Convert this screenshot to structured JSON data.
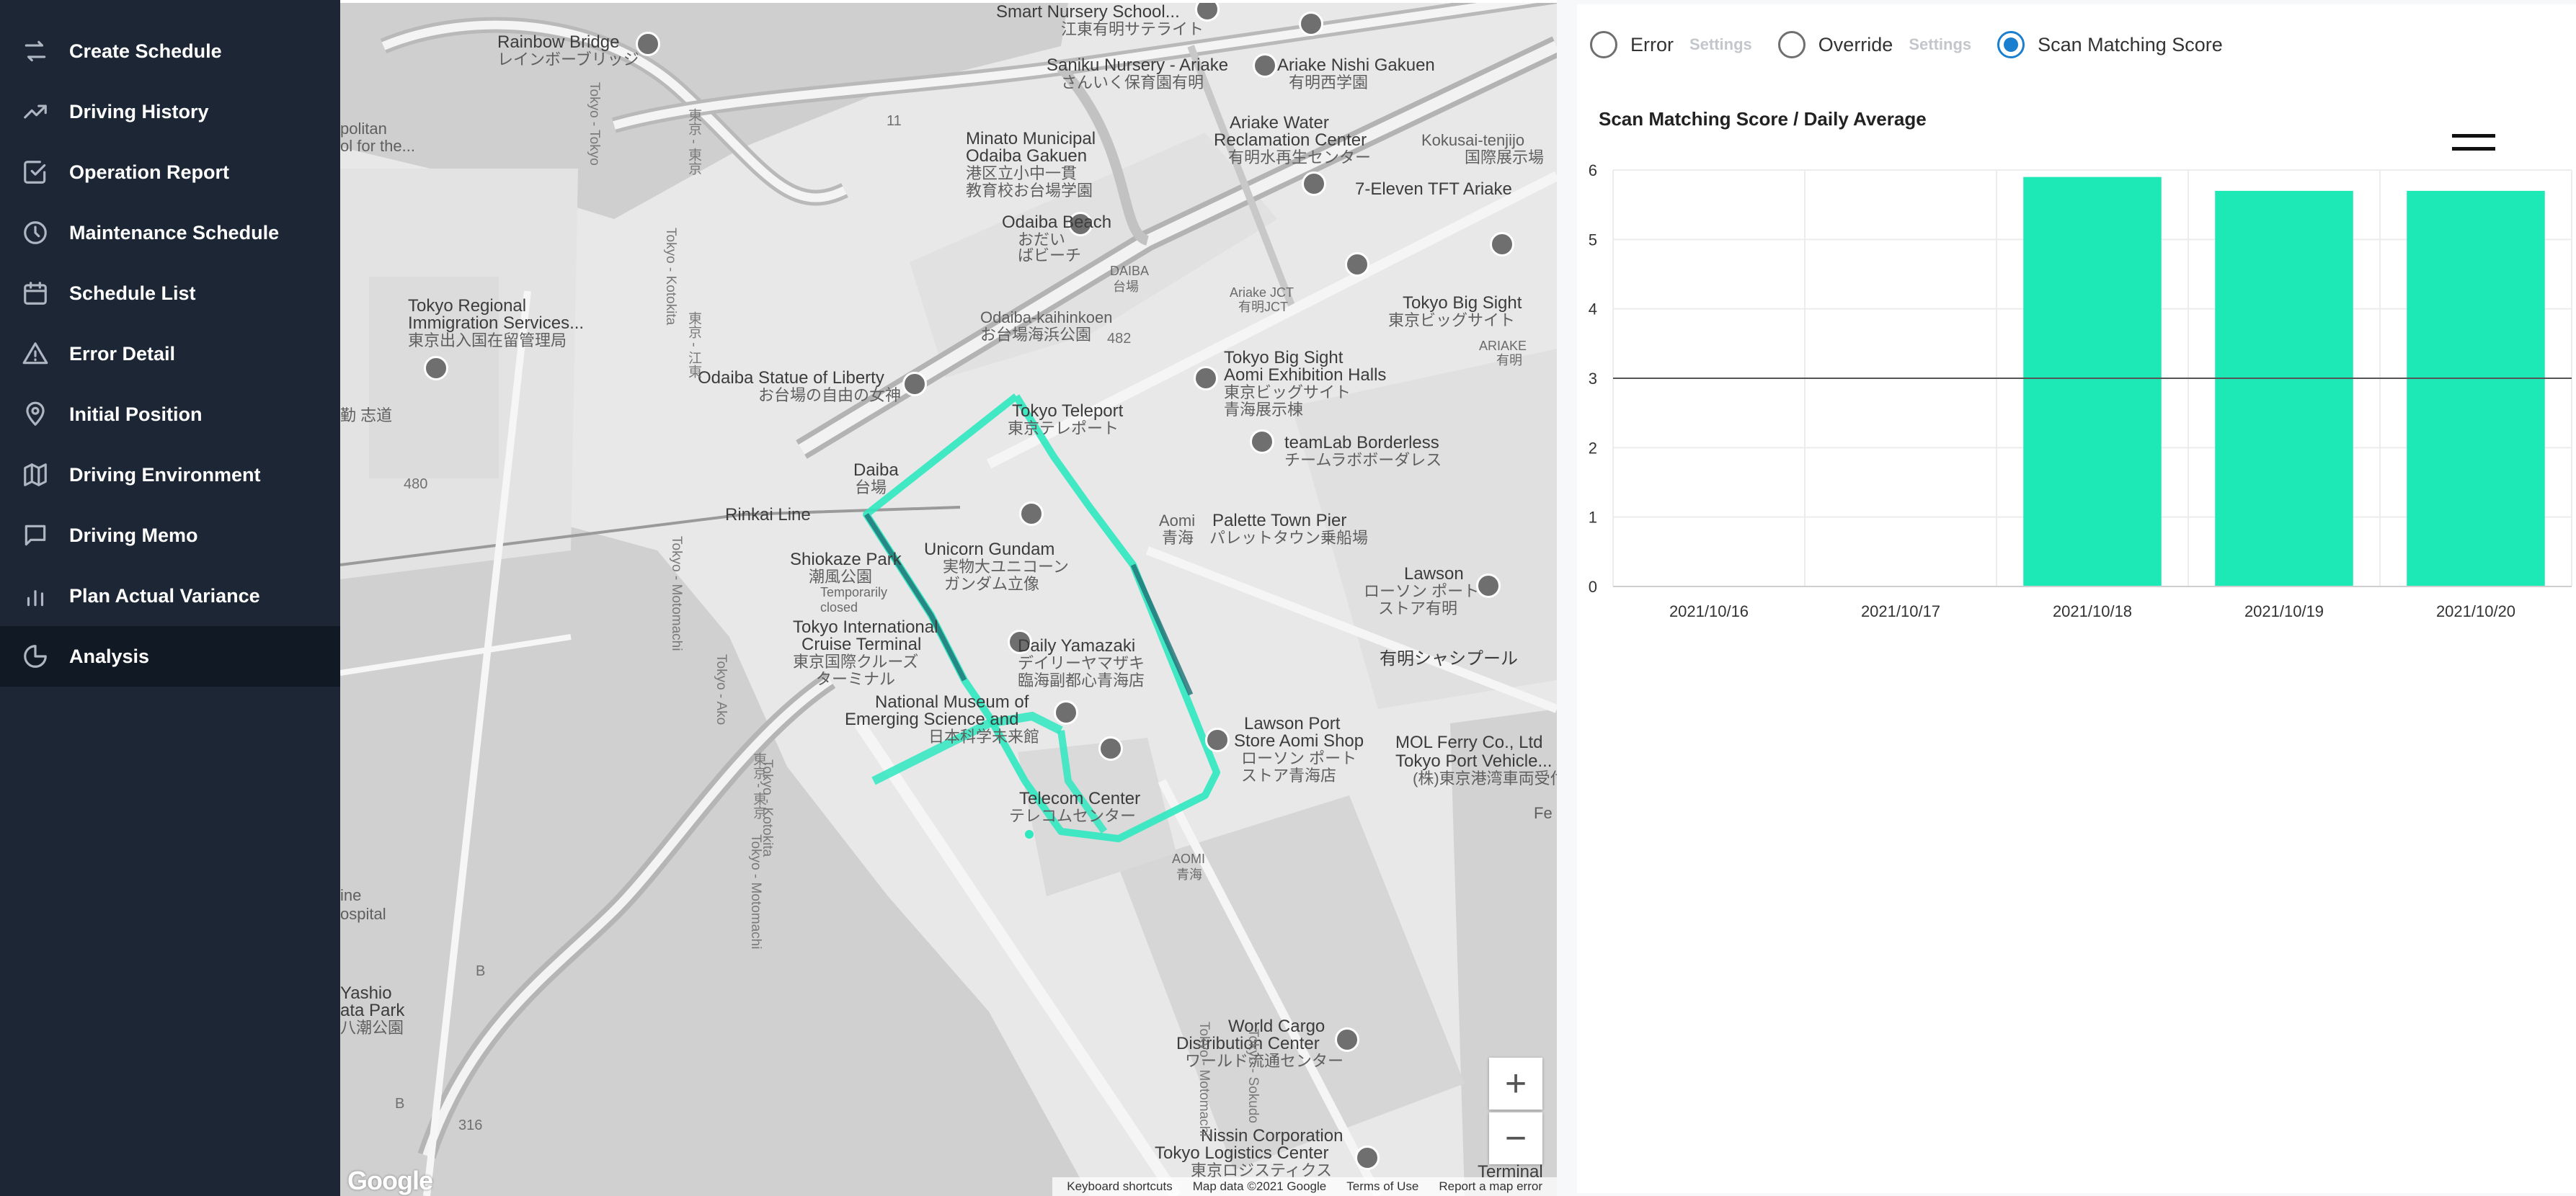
{
  "sidebar": {
    "items": [
      {
        "label": "Create Schedule",
        "icon": "swap-arrows-icon"
      },
      {
        "label": "Driving History",
        "icon": "trend-line-icon"
      },
      {
        "label": "Operation Report",
        "icon": "checkbox-icon"
      },
      {
        "label": "Maintenance Schedule",
        "icon": "clock-icon"
      },
      {
        "label": "Schedule List",
        "icon": "calendar-icon"
      },
      {
        "label": "Error Detail",
        "icon": "warning-icon"
      },
      {
        "label": "Initial Position",
        "icon": "location-pin-icon"
      },
      {
        "label": "Driving Environment",
        "icon": "map-icon"
      },
      {
        "label": "Driving Memo",
        "icon": "message-icon"
      },
      {
        "label": "Plan Actual Variance",
        "icon": "bar-chart-icon"
      },
      {
        "label": "Analysis",
        "icon": "pie-chart-icon",
        "active": true
      }
    ]
  },
  "map": {
    "labels": {
      "rainbow_bridge": "Rainbow Bridge",
      "rainbow_bridge_jp": "レインボーブリッジ",
      "smart_nursery": "Smart Nursery School...",
      "smart_nursery_jp": "江東有明サテライト",
      "saniku": "Saniku Nursery - Ariake",
      "saniku_jp": "さんいく保育園有明",
      "ariake_nishi": "Ariake Nishi Gakuen",
      "ariake_nishi_jp": "有明西学園",
      "minato_school": "Minato Municipal",
      "minato_school2": "Odaiba Gakuen",
      "minato_school_jp": "港区立小中一貫",
      "minato_school_jp2": "教育校お台場学園",
      "water_center": "Ariake Water",
      "water_center2": "Reclamation Center",
      "water_center_jp": "有明水再生センター",
      "seven_eleven": "7-Eleven TFT Ariake",
      "kokusai": "Kokusai-tenjijo",
      "kokusai_jp": "国際展示場",
      "odaiba_beach": "Odaiba Beach",
      "odaiba_beach_jp": "おだい",
      "odaiba_beach_jp2": "ばビーチ",
      "daiba": "DAIBA",
      "daiba_jp": "台場",
      "ariake_jct": "Ariake JCT",
      "ariake_jct_jp": "有明JCT",
      "kaihinkoen": "Odaiba-kaihinkoen",
      "kaihinkoen_jp": "お台場海浜公園",
      "big_sight": "Tokyo Big Sight",
      "big_sight_jp": "東京ビッグサイト",
      "ariake_label": "ARIAKE",
      "ariake_jp": "有明",
      "tokyo_regional": "Tokyo Regional",
      "tokyo_regional2": "Immigration Services...",
      "tokyo_regional_jp": "東京出入国在留管理局",
      "statue_liberty": "Odaiba Statue of Liberty",
      "statue_liberty_jp": "お台場の自由の女神",
      "tokyo_teleport": "Tokyo Teleport",
      "tokyo_teleport_jp": "東京テレポート",
      "big_sight_halls": "Tokyo Big Sight",
      "big_sight_halls2": "Aomi Exhibition Halls",
      "big_sight_halls_jp": "東京ビッグサイト",
      "big_sight_halls_jp2": "青海展示棟",
      "teamlab": "teamLab Borderless",
      "teamlab_jp": "チームラボボーダレス",
      "daiba_station": "Daiba",
      "daiba_station_jp": "台場",
      "rinkai_line": "Rinkai Line",
      "unicorn": "Unicorn Gundam",
      "unicorn_jp": "実物大ユニコーン",
      "unicorn_jp2": "ガンダム立像",
      "aomi": "Aomi",
      "aomi_jp": "青海",
      "palette_town": "Palette Town Pier",
      "palette_town_jp": "パレットタウン乗船場",
      "shiokaze": "Shiokaze Park",
      "shiokaze_jp": "潮風公園",
      "shiokaze_closed": "Temporarily closed",
      "lawson": "Lawson",
      "lawson_jp": "ローソン ポート",
      "lawson_jp2": "ストア有明",
      "cruise": "Tokyo International",
      "cruise2": "Cruise Terminal",
      "cruise_jp": "東京国際クルーズ",
      "cruise_jp2": "ターミナル",
      "daily_yamazaki": "Daily Yamazaki",
      "daily_yamazaki_jp": "デイリーヤマザキ",
      "daily_yamazaki_jp2": "臨海副都心青海店",
      "ariake_pool": "有明シャシプール",
      "museum": "National Museum of",
      "museum2": "Emerging Science and",
      "museum_jp": "日本科学未来館",
      "lawson_port": "Lawson Port",
      "lawson_port2": "Store Aomi Shop",
      "lawson_port_jp": "ローソン ポート",
      "lawson_port_jp2": "ストア青海店",
      "mol_ferry": "MOL Ferry Co., Ltd",
      "tokyo_port": "Tokyo Port Vehicle...",
      "tokyo_port_jp": "(株)東京港湾車両受付",
      "telecom": "Telecom Center",
      "telecom_jp": "テレコムセンター",
      "aomi_area": "AOMI",
      "aomi_area_jp": "青海",
      "hospital": "ine",
      "hospital2": "ospital",
      "yashio": "Yashio",
      "yashio2": "ata Park",
      "yashio_jp": "八潮公園",
      "world_cargo": "World Cargo",
      "world_cargo2": "Distribution Center",
      "world_cargo_jp": "ワールド流通センター",
      "nissin": "Nissin Corporation",
      "nissin2": "Tokyo Logistics Center",
      "nissin_jp": "東京ロジスティクス",
      "terminal": "Terminal",
      "politan": "politan",
      "politan2": "ol for the...",
      "shido": "勤 志道",
      "fe": "Fe",
      "road_11": "11",
      "road_482": "482",
      "road_480": "480",
      "road_316": "316",
      "road_b": "B",
      "road_b2": "B",
      "v_tokyo_tokyo": "Tokyo - Tokyo",
      "v_tokyo_jp": "東京 - 東京",
      "v_koto": "Tokyo - Kotokita",
      "v_koto_jp": "東京 - 江東",
      "v_motomachi": "Tokyo - Motomachi",
      "v_ako": "Tokyo - Ako",
      "v_kotokita2": "Tokyo - Kotokita",
      "v_sokudo": "Tokyo - Sokudo",
      "v_motomachi2": "Tokyo - Motomachi",
      "v_motomachi3": "Tokyo - Motomachi",
      "v_tokyo_jp2": "東京 - 東京"
    },
    "zoom_in": "+",
    "zoom_out": "−",
    "logo": "Google",
    "attribution": {
      "shortcuts": "Keyboard shortcuts",
      "data": "Map data ©2021 Google",
      "terms": "Terms of Use",
      "report": "Report a map error"
    },
    "route_color": "#2ee8c0"
  },
  "panel": {
    "options": [
      {
        "label": "Error",
        "settings": "Settings",
        "selected": false
      },
      {
        "label": "Override",
        "settings": "Settings",
        "selected": false
      },
      {
        "label": "Scan Matching Score",
        "selected": true
      }
    ],
    "accent": "#1a7fcf"
  },
  "chart_data": {
    "type": "bar",
    "title": "Scan Matching Score / Daily Average",
    "categories": [
      "2021/10/16",
      "2021/10/17",
      "2021/10/18",
      "2021/10/19",
      "2021/10/20"
    ],
    "values": [
      0,
      0,
      5.9,
      5.7,
      5.7
    ],
    "ylim": [
      0,
      6
    ],
    "yticks": [
      0,
      1,
      2,
      3,
      4,
      5,
      6
    ],
    "reference_line": 3,
    "bar_color": "#1de9b6",
    "grid": true,
    "xlabel": "",
    "ylabel": ""
  }
}
